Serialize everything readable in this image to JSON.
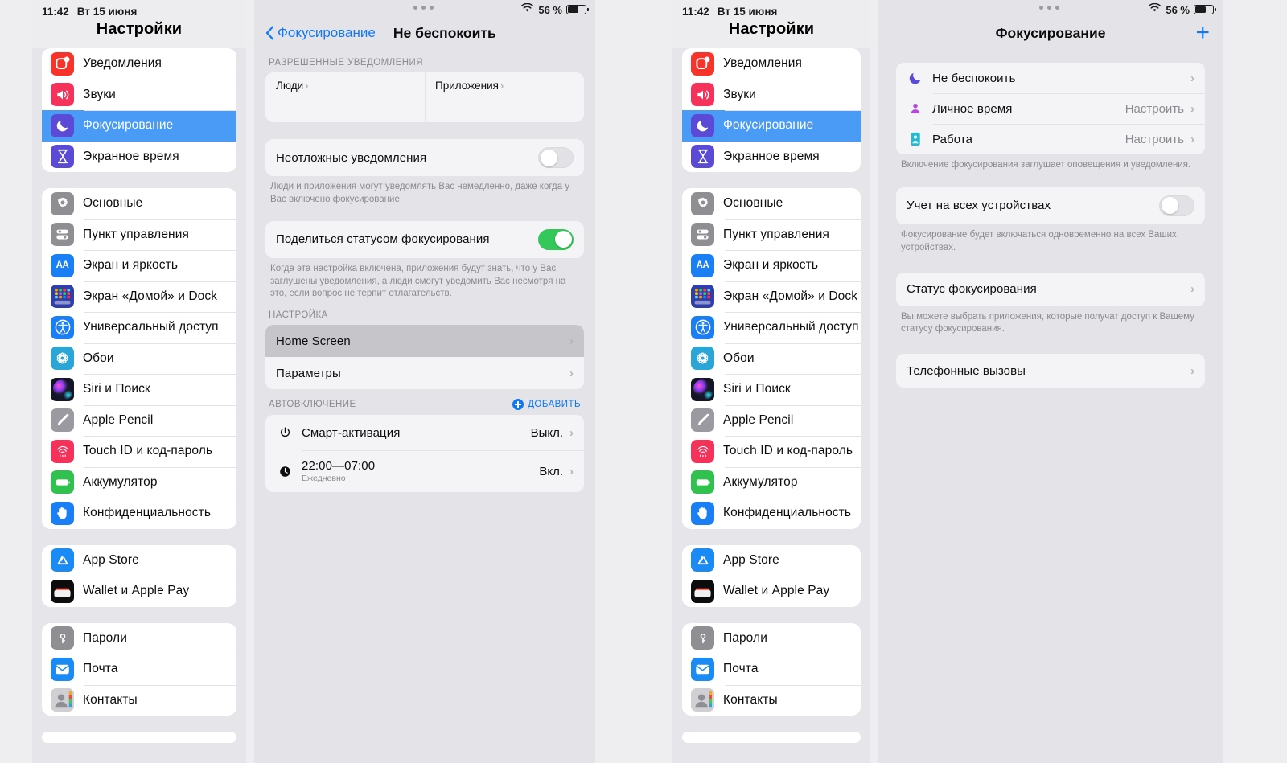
{
  "statusbar": {
    "time": "11:42",
    "date": "Вт 15 июня",
    "battery_pct": "56 %"
  },
  "sidebar": {
    "title": "Настройки",
    "groups": [
      {
        "items": [
          {
            "label": "Уведомления",
            "icon": "notifications-icon",
            "selected": false
          },
          {
            "label": "Звуки",
            "icon": "sounds-icon",
            "selected": false
          },
          {
            "label": "Фокусирование",
            "icon": "focus-moon-icon",
            "selected": true
          },
          {
            "label": "Экранное время",
            "icon": "screen-time-icon",
            "selected": false
          }
        ]
      },
      {
        "items": [
          {
            "label": "Основные",
            "icon": "general-gear-icon",
            "selected": false
          },
          {
            "label": "Пункт управления",
            "icon": "control-center-icon",
            "selected": false
          },
          {
            "label": "Экран и яркость",
            "icon": "display-brightness-icon",
            "selected": false
          },
          {
            "label": "Экран «Домой» и Dock",
            "icon": "home-screen-dock-icon",
            "selected": false
          },
          {
            "label": "Универсальный доступ",
            "icon": "accessibility-icon",
            "selected": false
          },
          {
            "label": "Обои",
            "icon": "wallpaper-icon",
            "selected": false
          },
          {
            "label": "Siri и Поиск",
            "icon": "siri-icon",
            "selected": false
          },
          {
            "label": "Apple Pencil",
            "icon": "apple-pencil-icon",
            "selected": false
          },
          {
            "label": "Touch ID и код-пароль",
            "icon": "touch-id-icon",
            "selected": false
          },
          {
            "label": "Аккумулятор",
            "icon": "battery-icon",
            "selected": false
          },
          {
            "label": "Конфиденциальность",
            "icon": "privacy-hand-icon",
            "selected": false
          }
        ]
      },
      {
        "items": [
          {
            "label": "App Store",
            "icon": "app-store-icon",
            "selected": false
          },
          {
            "label": "Wallet и Apple Pay",
            "icon": "wallet-icon",
            "selected": false
          }
        ]
      },
      {
        "items": [
          {
            "label": "Пароли",
            "icon": "passwords-key-icon",
            "selected": false
          },
          {
            "label": "Почта",
            "icon": "mail-icon",
            "selected": false
          },
          {
            "label": "Контакты",
            "icon": "contacts-icon",
            "selected": false
          }
        ]
      }
    ]
  },
  "dnd_panel": {
    "back_label": "Фокусирование",
    "title": "Не беспокоить",
    "allowed_header": "РАЗРЕШЕННЫЕ УВЕДОМЛЕНИЯ",
    "people_label": "Люди",
    "apps_label": "Приложения",
    "urgent_label": "Неотложные уведомления",
    "urgent_on": false,
    "urgent_note": "Люди и приложения могут уведомлять Вас немедленно, даже когда у Вас включено фокусирование.",
    "share_label": "Поделиться статусом фокусирования",
    "share_on": true,
    "share_note": "Когда эта настройка включена, приложения будут знать, что у Вас заглушены уведомления, а люди смогут уведомить Вас несмотря на это, если вопрос не терпит отлагательств.",
    "setup_header": "НАСТРОЙКА",
    "home_screen_label": "Home Screen",
    "params_label": "Параметры",
    "auto_header": "АВТОВКЛЮЧЕНИЕ",
    "add_label": "ДОБАВИТЬ",
    "smart_label": "Смарт-активация",
    "smart_value": "Выкл.",
    "schedule_label": "22:00—07:00",
    "schedule_sub": "Ежедневно",
    "schedule_value": "Вкл."
  },
  "focus_panel": {
    "title": "Фокусирование",
    "add_icon": "plus-icon",
    "modes": [
      {
        "label": "Не беспокоить",
        "value": "",
        "icon": "focus-moon-icon"
      },
      {
        "label": "Личное время",
        "value": "Настроить",
        "icon": "personal-person-icon"
      },
      {
        "label": "Работа",
        "value": "Настроить",
        "icon": "work-badge-icon"
      }
    ],
    "modes_note": "Включение фокусирования заглушает оповещения и уведомления.",
    "all_devices_label": "Учет на всех устройствах",
    "all_devices_on": false,
    "all_devices_note": "Фокусирование будет включаться одновременно на всех Ваших устройствах.",
    "status_label": "Статус фокусирования",
    "status_note": "Вы можете выбрать приложения, которые получат доступ к Вашему статусу фокусирования.",
    "calls_label": "Телефонные вызовы"
  }
}
